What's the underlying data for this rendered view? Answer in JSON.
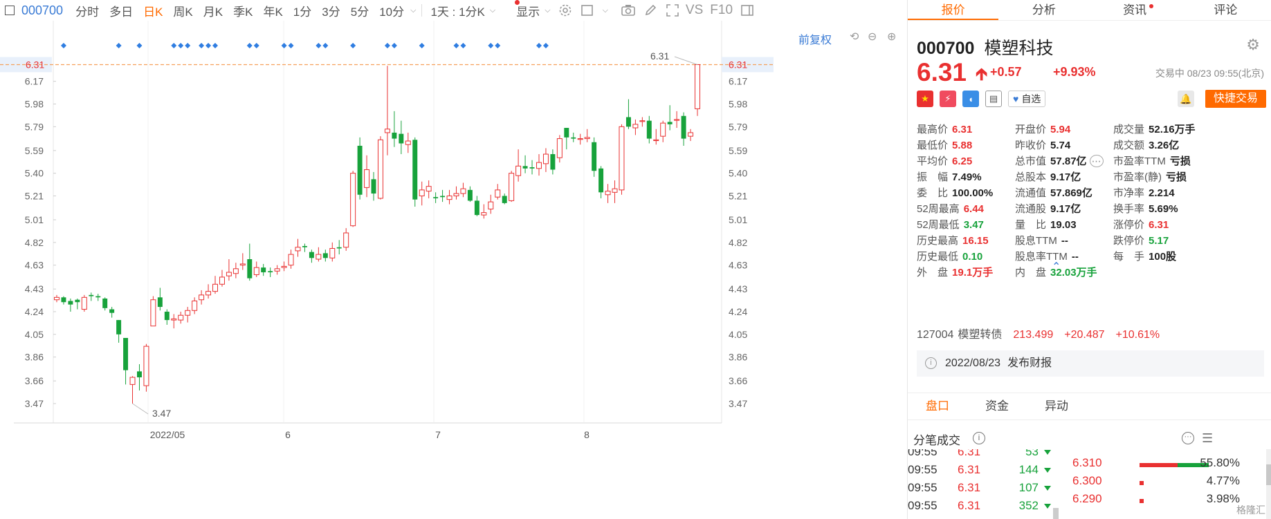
{
  "toolbar": {
    "code": "000700",
    "tabs": [
      "分时",
      "多日",
      "日K",
      "周K",
      "月K",
      "季K",
      "年K",
      "1分",
      "3分",
      "5分",
      "10分"
    ],
    "active_tab": "日K",
    "interval_select": "1天 : 1分K",
    "display_select": "显示",
    "vs_label": "VS",
    "f10_label": "F10"
  },
  "chart": {
    "adjust_label": "前复权",
    "price_levels": [
      "6.31",
      "6.17",
      "5.98",
      "5.79",
      "5.59",
      "5.40",
      "5.21",
      "5.01",
      "4.82",
      "4.63",
      "4.43",
      "4.24",
      "4.05",
      "3.86",
      "3.66",
      "3.47"
    ],
    "current_price_marker": "6.31",
    "low_annotation": "3.47",
    "high_annotation": "6.31",
    "x_labels": [
      "2022/05",
      "6",
      "7",
      "8"
    ],
    "colors": {
      "up": "#e93030",
      "down": "#17a23b",
      "marker": "#2f7de1",
      "dash": "#f5a05a"
    }
  },
  "chart_data": {
    "type": "candlestick",
    "ylim": [
      3.4,
      6.35
    ],
    "x_ticks": [
      "2022/05",
      "6",
      "7",
      "8"
    ],
    "low_label": "3.47",
    "high_label": "6.31",
    "candles": [
      [
        4.34,
        4.36,
        4.38,
        4.32
      ],
      [
        4.36,
        4.32,
        4.37,
        4.3
      ],
      [
        4.33,
        4.3,
        4.35,
        4.24
      ],
      [
        4.34,
        4.32,
        4.35,
        4.26
      ],
      [
        4.26,
        4.36,
        4.38,
        4.24
      ],
      [
        4.38,
        4.37,
        4.4,
        4.33
      ],
      [
        4.37,
        4.36,
        4.39,
        4.33
      ],
      [
        4.35,
        4.27,
        4.36,
        4.25
      ],
      [
        4.26,
        4.23,
        4.28,
        4.19
      ],
      [
        4.17,
        4.05,
        4.17,
        3.98
      ],
      [
        4.02,
        3.75,
        4.02,
        3.63
      ],
      [
        3.63,
        3.69,
        3.7,
        3.47
      ],
      [
        3.74,
        3.69,
        3.8,
        3.58
      ],
      [
        3.62,
        3.95,
        3.97,
        3.57
      ],
      [
        4.12,
        4.34,
        4.37,
        4.12
      ],
      [
        4.36,
        4.28,
        4.44,
        4.25
      ],
      [
        4.24,
        4.17,
        4.26,
        4.13
      ],
      [
        4.17,
        4.18,
        4.22,
        4.1
      ],
      [
        4.17,
        4.21,
        4.24,
        4.14
      ],
      [
        4.21,
        4.25,
        4.28,
        4.15
      ],
      [
        4.25,
        4.33,
        4.36,
        4.22
      ],
      [
        4.34,
        4.38,
        4.42,
        4.3
      ],
      [
        4.38,
        4.41,
        4.47,
        4.35
      ],
      [
        4.41,
        4.47,
        4.54,
        4.39
      ],
      [
        4.47,
        4.53,
        4.59,
        4.45
      ],
      [
        4.54,
        4.57,
        4.68,
        4.5
      ],
      [
        4.56,
        4.6,
        4.65,
        4.52
      ],
      [
        4.63,
        4.64,
        4.73,
        4.59
      ],
      [
        4.68,
        4.52,
        4.81,
        4.5
      ],
      [
        4.55,
        4.61,
        4.66,
        4.53
      ],
      [
        4.61,
        4.57,
        4.64,
        4.54
      ],
      [
        4.58,
        4.57,
        4.61,
        4.53
      ],
      [
        4.58,
        4.6,
        4.63,
        4.55
      ],
      [
        4.61,
        4.62,
        4.66,
        4.58
      ],
      [
        4.63,
        4.72,
        4.76,
        4.6
      ],
      [
        4.75,
        4.78,
        4.85,
        4.7
      ],
      [
        4.79,
        4.78,
        4.81,
        4.74
      ],
      [
        4.74,
        4.69,
        4.76,
        4.65
      ],
      [
        4.68,
        4.72,
        4.78,
        4.66
      ],
      [
        4.73,
        4.69,
        4.76,
        4.66
      ],
      [
        4.69,
        4.77,
        4.82,
        4.66
      ],
      [
        4.78,
        4.77,
        4.84,
        4.72
      ],
      [
        4.78,
        4.9,
        4.94,
        4.75
      ],
      [
        4.96,
        5.4,
        5.42,
        4.95
      ],
      [
        5.63,
        5.22,
        5.7,
        5.18
      ],
      [
        5.28,
        5.43,
        5.55,
        5.2
      ],
      [
        5.35,
        5.23,
        5.41,
        5.17
      ],
      [
        5.19,
        5.68,
        5.71,
        5.18
      ],
      [
        5.74,
        5.77,
        6.3,
        5.55
      ],
      [
        5.74,
        5.69,
        5.92,
        5.62
      ],
      [
        5.73,
        5.65,
        5.84,
        5.56
      ],
      [
        5.64,
        5.67,
        5.74,
        5.57
      ],
      [
        5.68,
        5.18,
        5.7,
        5.12
      ],
      [
        5.21,
        5.26,
        5.33,
        5.13
      ],
      [
        5.25,
        5.29,
        5.34,
        5.19
      ],
      [
        5.2,
        5.19,
        5.24,
        5.15
      ],
      [
        5.21,
        5.2,
        5.26,
        5.16
      ],
      [
        5.18,
        5.21,
        5.26,
        5.14
      ],
      [
        5.21,
        5.23,
        5.29,
        5.18
      ],
      [
        5.23,
        5.27,
        5.32,
        5.2
      ],
      [
        5.26,
        5.17,
        5.29,
        5.16
      ],
      [
        5.17,
        5.05,
        5.21,
        5.04
      ],
      [
        5.05,
        5.07,
        5.14,
        5.02
      ],
      [
        5.1,
        5.16,
        5.22,
        5.06
      ],
      [
        5.2,
        5.26,
        5.31,
        5.18
      ],
      [
        5.21,
        5.15,
        5.23,
        5.14
      ],
      [
        5.17,
        5.4,
        5.42,
        5.16
      ],
      [
        5.38,
        5.46,
        5.6,
        5.33
      ],
      [
        5.46,
        5.44,
        5.55,
        5.4
      ],
      [
        5.45,
        5.44,
        5.51,
        5.39
      ],
      [
        5.44,
        5.49,
        5.56,
        5.38
      ],
      [
        5.48,
        5.56,
        5.61,
        5.41
      ],
      [
        5.56,
        5.43,
        5.6,
        5.39
      ],
      [
        5.53,
        5.69,
        5.72,
        5.49
      ],
      [
        5.78,
        5.7,
        5.78,
        5.6
      ],
      [
        5.7,
        5.69,
        5.74,
        5.66
      ],
      [
        5.69,
        5.69,
        5.73,
        5.64
      ],
      [
        5.69,
        5.7,
        5.77,
        5.66
      ],
      [
        5.66,
        5.42,
        5.7,
        5.37
      ],
      [
        5.44,
        5.24,
        5.46,
        5.19
      ],
      [
        5.22,
        5.25,
        5.31,
        5.15
      ],
      [
        5.24,
        5.27,
        5.34,
        5.15
      ],
      [
        5.26,
        5.79,
        5.81,
        5.22
      ],
      [
        5.87,
        5.79,
        6.02,
        5.77
      ],
      [
        5.78,
        5.81,
        5.85,
        5.72
      ],
      [
        5.84,
        5.84,
        5.87,
        5.79
      ],
      [
        5.84,
        5.69,
        5.88,
        5.65
      ],
      [
        5.68,
        5.68,
        5.77,
        5.64
      ],
      [
        5.71,
        5.82,
        5.84,
        5.66
      ],
      [
        5.83,
        5.81,
        5.97,
        5.76
      ],
      [
        5.85,
        5.85,
        5.92,
        5.78
      ],
      [
        5.88,
        5.69,
        5.91,
        5.63
      ],
      [
        5.71,
        5.74,
        5.77,
        5.67
      ],
      [
        5.94,
        6.31,
        6.31,
        5.88
      ]
    ],
    "event_markers": [
      1,
      9,
      12,
      17,
      18,
      19,
      21,
      22,
      23,
      28,
      29,
      33,
      34,
      38,
      39,
      43,
      48,
      49,
      53,
      58,
      59,
      63,
      64,
      70,
      71
    ]
  },
  "right_panel": {
    "tabs": [
      "报价",
      "分析",
      "资讯",
      "评论"
    ],
    "active_tab": "报价",
    "code": "000700",
    "name": "模塑科技",
    "price": "6.31",
    "change": "+0.57",
    "change_pct": "+9.93%",
    "trade_time": "交易中 08/23 09:55(北京)",
    "watchlist_label": "自选",
    "quick_trade": "快捷交易",
    "stats": [
      {
        "label": "最高价",
        "value": "6.31",
        "color": "red"
      },
      {
        "label": "开盘价",
        "value": "5.94",
        "color": "red"
      },
      {
        "label": "成交量",
        "value": "52.16万手",
        "color": "dark"
      },
      {
        "label": "最低价",
        "value": "5.88",
        "color": "red"
      },
      {
        "label": "昨收价",
        "value": "5.74",
        "color": "dark"
      },
      {
        "label": "成交额",
        "value": "3.26亿",
        "color": "dark"
      },
      {
        "label": "平均价",
        "value": "6.25",
        "color": "red"
      },
      {
        "label": "总市值",
        "value": "57.87亿",
        "color": "dark"
      },
      {
        "label": "市盈率TTM",
        "value": "亏损",
        "color": "dark"
      },
      {
        "label": "振　幅",
        "value": "7.49%",
        "color": "dark"
      },
      {
        "label": "总股本",
        "value": "9.17亿",
        "color": "dark"
      },
      {
        "label": "市盈率(静)",
        "value": "亏损",
        "color": "dark"
      },
      {
        "label": "委　比",
        "value": "100.00%",
        "color": "dark"
      },
      {
        "label": "流通值",
        "value": "57.869亿",
        "color": "dark"
      },
      {
        "label": "市净率",
        "value": "2.214",
        "color": "dark"
      },
      {
        "label": "52周最高",
        "value": "6.44",
        "color": "red"
      },
      {
        "label": "流通股",
        "value": "9.17亿",
        "color": "dark"
      },
      {
        "label": "换手率",
        "value": "5.69%",
        "color": "dark"
      },
      {
        "label": "52周最低",
        "value": "3.47",
        "color": "green"
      },
      {
        "label": "量　比",
        "value": "19.03",
        "color": "dark"
      },
      {
        "label": "涨停价",
        "value": "6.31",
        "color": "red"
      },
      {
        "label": "历史最高",
        "value": "16.15",
        "color": "red"
      },
      {
        "label": "股息TTM",
        "value": "--",
        "color": "dark"
      },
      {
        "label": "跌停价",
        "value": "5.17",
        "color": "green"
      },
      {
        "label": "历史最低",
        "value": "0.10",
        "color": "green"
      },
      {
        "label": "股息率TTM",
        "value": "--",
        "color": "dark"
      },
      {
        "label": "每　手",
        "value": "100股",
        "color": "dark"
      },
      {
        "label": "外　盘",
        "value": "19.1万手",
        "color": "red"
      },
      {
        "label": "内　盘",
        "value": "32.03万手",
        "color": "green"
      }
    ],
    "bond": {
      "code": "127004",
      "name": "模塑转债",
      "price": "213.499",
      "change": "+20.487",
      "pct": "+10.61%"
    },
    "notice": {
      "date": "2022/08/23",
      "text": "发布财报"
    },
    "sub_tabs": [
      "盘口",
      "资金",
      "异动"
    ],
    "active_sub_tab": "盘口",
    "ticks_title": "分笔成交",
    "ticks": [
      {
        "time": "09:55",
        "price": "6.31",
        "vol": "53"
      },
      {
        "time": "09:55",
        "price": "6.31",
        "vol": "144"
      },
      {
        "time": "09:55",
        "price": "6.31",
        "vol": "107"
      },
      {
        "time": "09:55",
        "price": "6.31",
        "vol": "352"
      }
    ],
    "distribution": [
      {
        "price": "6.310",
        "pct": "55.80%",
        "red_share": 0.55
      },
      {
        "price": "6.300",
        "pct": "4.77%",
        "red_share": 0.05
      },
      {
        "price": "6.290",
        "pct": "3.98%",
        "red_share": 0.04
      }
    ],
    "watermark": "格隆汇"
  }
}
